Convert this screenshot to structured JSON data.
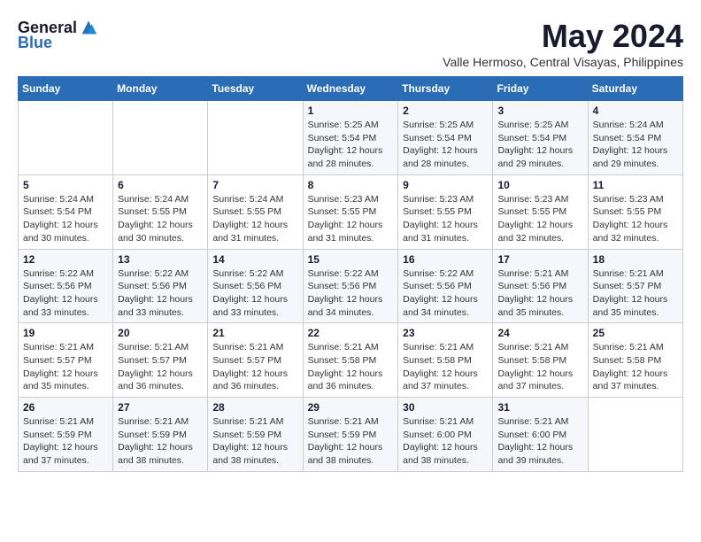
{
  "header": {
    "logo_general": "General",
    "logo_blue": "Blue",
    "month_title": "May 2024",
    "location": "Valle Hermoso, Central Visayas, Philippines"
  },
  "weekdays": [
    "Sunday",
    "Monday",
    "Tuesday",
    "Wednesday",
    "Thursday",
    "Friday",
    "Saturday"
  ],
  "weeks": [
    [
      {
        "day": "",
        "info": ""
      },
      {
        "day": "",
        "info": ""
      },
      {
        "day": "",
        "info": ""
      },
      {
        "day": "1",
        "info": "Sunrise: 5:25 AM\nSunset: 5:54 PM\nDaylight: 12 hours and 28 minutes."
      },
      {
        "day": "2",
        "info": "Sunrise: 5:25 AM\nSunset: 5:54 PM\nDaylight: 12 hours and 28 minutes."
      },
      {
        "day": "3",
        "info": "Sunrise: 5:25 AM\nSunset: 5:54 PM\nDaylight: 12 hours and 29 minutes."
      },
      {
        "day": "4",
        "info": "Sunrise: 5:24 AM\nSunset: 5:54 PM\nDaylight: 12 hours and 29 minutes."
      }
    ],
    [
      {
        "day": "5",
        "info": "Sunrise: 5:24 AM\nSunset: 5:54 PM\nDaylight: 12 hours and 30 minutes."
      },
      {
        "day": "6",
        "info": "Sunrise: 5:24 AM\nSunset: 5:55 PM\nDaylight: 12 hours and 30 minutes."
      },
      {
        "day": "7",
        "info": "Sunrise: 5:24 AM\nSunset: 5:55 PM\nDaylight: 12 hours and 31 minutes."
      },
      {
        "day": "8",
        "info": "Sunrise: 5:23 AM\nSunset: 5:55 PM\nDaylight: 12 hours and 31 minutes."
      },
      {
        "day": "9",
        "info": "Sunrise: 5:23 AM\nSunset: 5:55 PM\nDaylight: 12 hours and 31 minutes."
      },
      {
        "day": "10",
        "info": "Sunrise: 5:23 AM\nSunset: 5:55 PM\nDaylight: 12 hours and 32 minutes."
      },
      {
        "day": "11",
        "info": "Sunrise: 5:23 AM\nSunset: 5:55 PM\nDaylight: 12 hours and 32 minutes."
      }
    ],
    [
      {
        "day": "12",
        "info": "Sunrise: 5:22 AM\nSunset: 5:56 PM\nDaylight: 12 hours and 33 minutes."
      },
      {
        "day": "13",
        "info": "Sunrise: 5:22 AM\nSunset: 5:56 PM\nDaylight: 12 hours and 33 minutes."
      },
      {
        "day": "14",
        "info": "Sunrise: 5:22 AM\nSunset: 5:56 PM\nDaylight: 12 hours and 33 minutes."
      },
      {
        "day": "15",
        "info": "Sunrise: 5:22 AM\nSunset: 5:56 PM\nDaylight: 12 hours and 34 minutes."
      },
      {
        "day": "16",
        "info": "Sunrise: 5:22 AM\nSunset: 5:56 PM\nDaylight: 12 hours and 34 minutes."
      },
      {
        "day": "17",
        "info": "Sunrise: 5:21 AM\nSunset: 5:56 PM\nDaylight: 12 hours and 35 minutes."
      },
      {
        "day": "18",
        "info": "Sunrise: 5:21 AM\nSunset: 5:57 PM\nDaylight: 12 hours and 35 minutes."
      }
    ],
    [
      {
        "day": "19",
        "info": "Sunrise: 5:21 AM\nSunset: 5:57 PM\nDaylight: 12 hours and 35 minutes."
      },
      {
        "day": "20",
        "info": "Sunrise: 5:21 AM\nSunset: 5:57 PM\nDaylight: 12 hours and 36 minutes."
      },
      {
        "day": "21",
        "info": "Sunrise: 5:21 AM\nSunset: 5:57 PM\nDaylight: 12 hours and 36 minutes."
      },
      {
        "day": "22",
        "info": "Sunrise: 5:21 AM\nSunset: 5:58 PM\nDaylight: 12 hours and 36 minutes."
      },
      {
        "day": "23",
        "info": "Sunrise: 5:21 AM\nSunset: 5:58 PM\nDaylight: 12 hours and 37 minutes."
      },
      {
        "day": "24",
        "info": "Sunrise: 5:21 AM\nSunset: 5:58 PM\nDaylight: 12 hours and 37 minutes."
      },
      {
        "day": "25",
        "info": "Sunrise: 5:21 AM\nSunset: 5:58 PM\nDaylight: 12 hours and 37 minutes."
      }
    ],
    [
      {
        "day": "26",
        "info": "Sunrise: 5:21 AM\nSunset: 5:59 PM\nDaylight: 12 hours and 37 minutes."
      },
      {
        "day": "27",
        "info": "Sunrise: 5:21 AM\nSunset: 5:59 PM\nDaylight: 12 hours and 38 minutes."
      },
      {
        "day": "28",
        "info": "Sunrise: 5:21 AM\nSunset: 5:59 PM\nDaylight: 12 hours and 38 minutes."
      },
      {
        "day": "29",
        "info": "Sunrise: 5:21 AM\nSunset: 5:59 PM\nDaylight: 12 hours and 38 minutes."
      },
      {
        "day": "30",
        "info": "Sunrise: 5:21 AM\nSunset: 6:00 PM\nDaylight: 12 hours and 38 minutes."
      },
      {
        "day": "31",
        "info": "Sunrise: 5:21 AM\nSunset: 6:00 PM\nDaylight: 12 hours and 39 minutes."
      },
      {
        "day": "",
        "info": ""
      }
    ]
  ]
}
